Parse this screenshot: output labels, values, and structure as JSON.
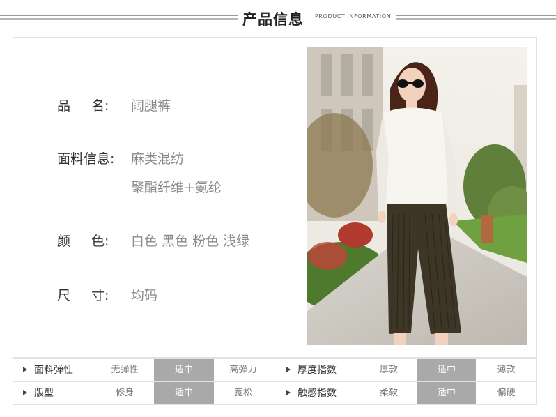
{
  "header": {
    "title_cn": "产品信息",
    "title_en": "PRODUCT INFORMATION"
  },
  "info": {
    "name_label": [
      "品",
      "名:"
    ],
    "name_value": "阔腿裤",
    "fabric_label": "面料信息:",
    "fabric_value_1": "麻类混纺",
    "fabric_value_2": "聚酯纤维+氨纶",
    "color_label": [
      "颜",
      "色:"
    ],
    "color_value": "白色 黑色 粉色 浅绿",
    "size_label": [
      "尺",
      "寸:"
    ],
    "size_value": "均码"
  },
  "table": {
    "rows": [
      {
        "left_label": "面料弹性",
        "left_options": [
          "无弹性",
          "适中",
          "高弹力"
        ],
        "left_selected": 1,
        "right_label": "厚度指数",
        "right_options": [
          "厚款",
          "适中",
          "薄款"
        ],
        "right_selected": 1
      },
      {
        "left_label": "版型",
        "left_options": [
          "修身",
          "适中",
          "宽松"
        ],
        "left_selected": 1,
        "right_label": "触感指数",
        "right_options": [
          "柔软",
          "适中",
          "偏硬"
        ],
        "right_selected": 1
      }
    ]
  },
  "colors": {
    "selected_cell": "#a9a9a9",
    "label": "#333333",
    "value": "#8a8a8a"
  }
}
